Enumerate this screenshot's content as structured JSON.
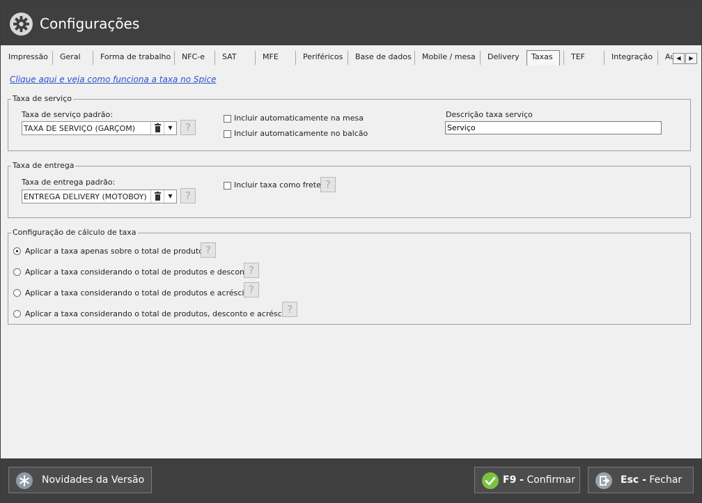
{
  "window": {
    "title": "Configurações",
    "title_icon": "gear-icon"
  },
  "tabs": {
    "items": [
      {
        "label": "Impressão"
      },
      {
        "label": "Geral"
      },
      {
        "label": "Forma de trabalho"
      },
      {
        "label": "NFC-e"
      },
      {
        "label": "SAT"
      },
      {
        "label": "MFE"
      },
      {
        "label": "Periféricos"
      },
      {
        "label": "Base de dados"
      },
      {
        "label": "Mobile / mesa"
      },
      {
        "label": "Delivery"
      },
      {
        "label": "Taxas"
      },
      {
        "label": "TEF"
      },
      {
        "label": "Integração"
      },
      {
        "label": "Au"
      }
    ],
    "active": "Taxas",
    "scroll_left": "◀",
    "scroll_right": "▶"
  },
  "help_link": "Clique aqui e veja como funciona a taxa no Spice",
  "service_fee": {
    "legend": "Taxa de serviço",
    "default_label": "Taxa de serviço padrão:",
    "default_value": "TAXA DE SERVIÇO (GARÇOM)",
    "auto_table_label": "Incluir automaticamente na mesa",
    "auto_table_checked": false,
    "auto_counter_label": "Incluir automaticamente no balcão",
    "auto_counter_checked": false,
    "description_label": "Descrição taxa serviço",
    "description_value": "Serviço",
    "help_glyph": "?"
  },
  "delivery_fee": {
    "legend": "Taxa de entrega",
    "default_label": "Taxa de entrega padrão:",
    "default_value": "ENTREGA  DELIVERY (MOTOBOY)",
    "freight_label": "Incluir taxa como frete",
    "freight_checked": false,
    "help_glyph": "?"
  },
  "calc_config": {
    "legend": "Configuração de cálculo de taxa",
    "options": [
      {
        "label": "Aplicar a taxa apenas sobre o total de produtos",
        "selected": true
      },
      {
        "label": "Aplicar a taxa considerando o total de produtos e desconto",
        "selected": false
      },
      {
        "label": "Aplicar a taxa considerando o total de produtos e acréscimo",
        "selected": false
      },
      {
        "label": "Aplicar a taxa considerando o total de produtos, desconto e acréscimo",
        "selected": false
      }
    ],
    "help_glyph": "?"
  },
  "footer": {
    "news_label": "Novidades da Versão",
    "confirm_key": "F9 -",
    "confirm_label": "Confirmar",
    "close_key": "Esc -",
    "close_label": "Fechar"
  },
  "colors": {
    "titlebar": "#3f3f3f",
    "link": "#2b50cc",
    "confirm_icon": "#7cc242"
  }
}
